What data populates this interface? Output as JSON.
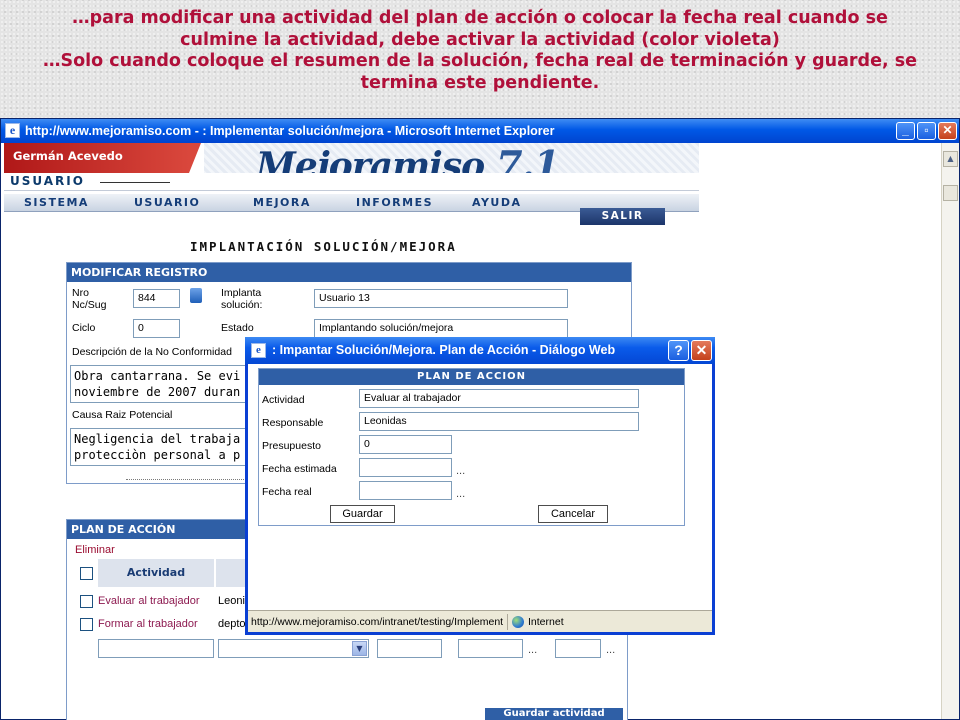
{
  "caption": {
    "line1": "…para modificar una actividad del plan de acción o colocar la fecha real cuando se",
    "line2": "culmine la actividad, debe activar la actividad (color violeta)",
    "line3": "…Solo cuando coloque el resumen de la solución, fecha real de terminación y guarde, se",
    "line4": "termina este pendiente."
  },
  "browser": {
    "title": "http://www.mejoramiso.com - : Implementar solución/mejora - Microsoft Internet Explorer",
    "minimize": "_",
    "maximize": "▫",
    "close": "✕"
  },
  "header": {
    "user_name": "Germán Acevedo",
    "usuario_label": "USUARIO",
    "logo_name": "Mejoramiso",
    "logo_version": "7.1"
  },
  "menu": [
    "SISTEMA",
    "USUARIO",
    "MEJORA",
    "INFORMES",
    "AYUDA"
  ],
  "salir": "SALIR",
  "page_title": "IMPLANTACIÓN SOLUCIÓN/MEJORA",
  "modificar": {
    "heading": "MODIFICAR REGISTRO",
    "nro_label_1": "Nro",
    "nro_label_2": "Nc/Sug",
    "nro_value": "844",
    "implanta_label_1": "Implanta",
    "implanta_label_2": "solución:",
    "implanta_value": "Usuario 13",
    "ciclo_label": "Ciclo",
    "ciclo_value": "0",
    "estado_label": "Estado",
    "estado_value": "Implantando solución/mejora",
    "descripcion_label": "Descripción de la No Conformidad",
    "descripcion_line1": "Obra cantarrana. Se evi",
    "descripcion_line2": "noviembre de 2007 duran",
    "causa_label": "Causa Raiz Potencial",
    "causa_line1": "Negligencia del trabaja",
    "causa_line2": "protecciòn personal a p"
  },
  "plan": {
    "heading": "PLAN DE ACCIÓN",
    "eliminar": "Eliminar",
    "col_actividad": "Actividad",
    "rows": [
      {
        "actividad": "Evaluar al trabajador",
        "responsable": "Leoni"
      },
      {
        "actividad": "Formar al trabajador",
        "responsable": "depto"
      }
    ],
    "ellipsis": "...",
    "guardar_actividad": "Guardar actividad"
  },
  "dialog": {
    "title": ": Impantar Solución/Mejora. Plan de Acción - Diálogo Web",
    "help": "?",
    "close": "✕",
    "heading": "PLAN DE ACCION",
    "actividad_label": "Actividad",
    "actividad_value": "Evaluar al trabajador",
    "responsable_label": "Responsable",
    "responsable_value": "Leonidas",
    "presupuesto_label": "Presupuesto",
    "presupuesto_value": "0",
    "fecha_estimada_label": "Fecha estimada",
    "fecha_real_label": "Fecha real",
    "ellipsis": "...",
    "guardar": "Guardar",
    "cancelar": "Cancelar",
    "status_url": "http://www.mejoramiso.com/intranet/testing/Implement",
    "status_zone": "Internet"
  }
}
